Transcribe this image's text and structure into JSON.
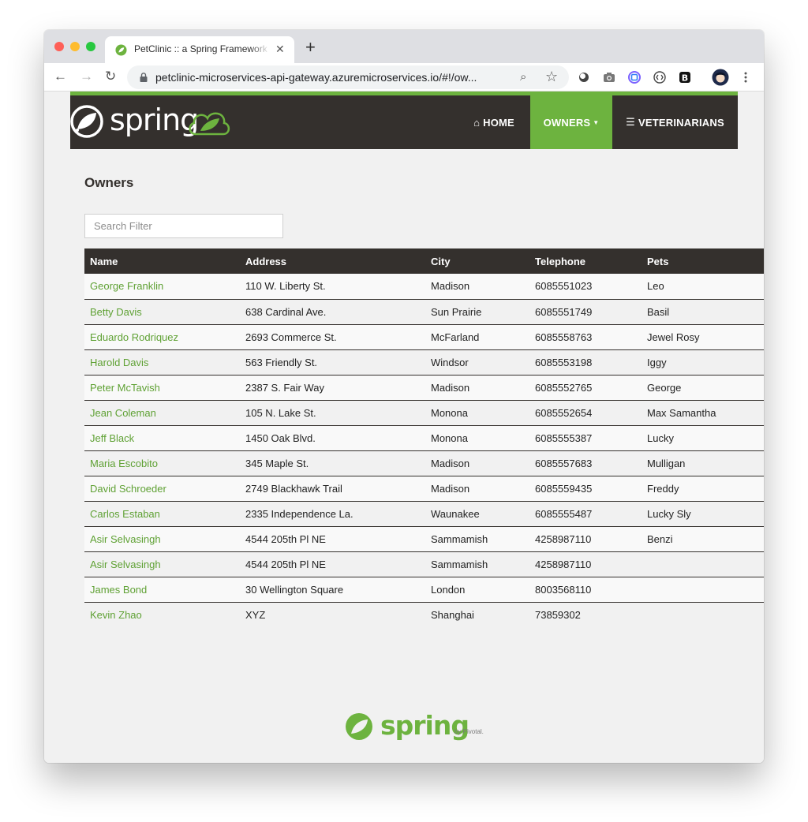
{
  "browser": {
    "tab_title": "PetClinic :: a Spring Framework",
    "tab_close": "✕",
    "new_tab": "+",
    "url": "petclinic-microservices-api-gateway.azuremicroservices.io/#!/ow...",
    "back": "←",
    "forward": "→",
    "reload": "↻",
    "zoom_glyph": "⌕",
    "star_glyph": "☆"
  },
  "navbar": {
    "brand": "spring",
    "items": [
      {
        "label": "HOME",
        "icon": "home-icon"
      },
      {
        "label": "OWNERS",
        "icon": "caret-down-icon"
      },
      {
        "label": "VETERINARIANS",
        "icon": "list-icon"
      }
    ]
  },
  "page": {
    "title": "Owners",
    "search_placeholder": "Search Filter"
  },
  "table": {
    "headers": [
      "Name",
      "Address",
      "City",
      "Telephone",
      "Pets"
    ],
    "rows": [
      [
        "George Franklin",
        "110 W. Liberty St.",
        "Madison",
        "6085551023",
        "Leo"
      ],
      [
        "Betty Davis",
        "638 Cardinal Ave.",
        "Sun Prairie",
        "6085551749",
        "Basil"
      ],
      [
        "Eduardo Rodriquez",
        "2693 Commerce St.",
        "McFarland",
        "6085558763",
        "Jewel Rosy"
      ],
      [
        "Harold Davis",
        "563 Friendly St.",
        "Windsor",
        "6085553198",
        "Iggy"
      ],
      [
        "Peter McTavish",
        "2387 S. Fair Way",
        "Madison",
        "6085552765",
        "George"
      ],
      [
        "Jean Coleman",
        "105 N. Lake St.",
        "Monona",
        "6085552654",
        "Max Samantha"
      ],
      [
        "Jeff Black",
        "1450 Oak Blvd.",
        "Monona",
        "6085555387",
        "Lucky"
      ],
      [
        "Maria Escobito",
        "345 Maple St.",
        "Madison",
        "6085557683",
        "Mulligan"
      ],
      [
        "David Schroeder",
        "2749 Blackhawk Trail",
        "Madison",
        "6085559435",
        "Freddy"
      ],
      [
        "Carlos Estaban",
        "2335 Independence La.",
        "Waunakee",
        "6085555487",
        "Lucky Sly"
      ],
      [
        "Asir Selvasingh",
        "4544 205th Pl NE",
        "Sammamish",
        "4258987110",
        "Benzi"
      ],
      [
        "Asir Selvasingh",
        "4544 205th Pl NE",
        "Sammamish",
        "4258987110",
        ""
      ],
      [
        "James Bond",
        "30 Wellington Square",
        "London",
        "8003568110",
        ""
      ],
      [
        "Kevin Zhao",
        "XYZ",
        "Shanghai",
        "73859302",
        ""
      ]
    ]
  },
  "footer": {
    "brand": "spring",
    "tagline": "by Pivotal."
  },
  "colors": {
    "spring_green": "#6db33f",
    "navbar_dark": "#34302d",
    "link_green": "#5fa134"
  }
}
